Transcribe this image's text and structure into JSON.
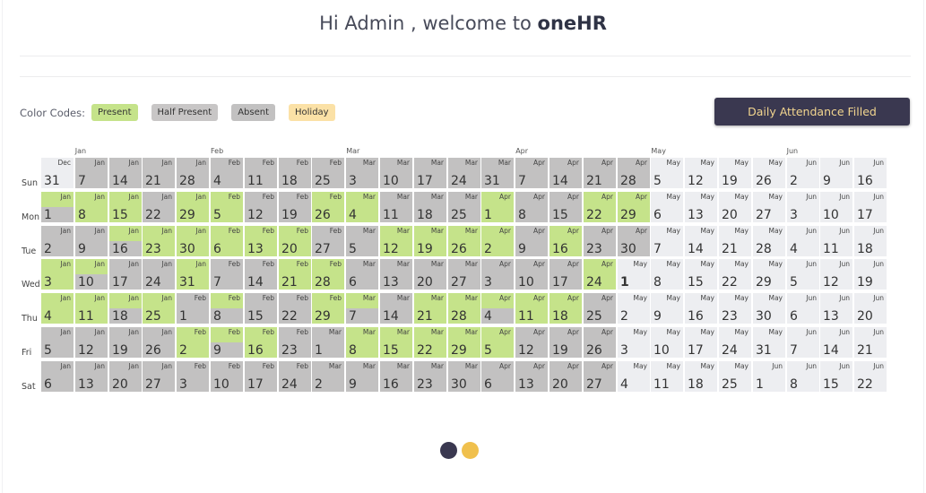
{
  "header": {
    "greeting": "Hi Admin , welcome to",
    "brand": "oneHR"
  },
  "legend": {
    "label": "Color Codes:",
    "items": [
      {
        "label": "Present",
        "kind": "present"
      },
      {
        "label": "Half Present",
        "kind": "half"
      },
      {
        "label": "Absent",
        "kind": "absent"
      },
      {
        "label": "Holiday",
        "kind": "holiday"
      }
    ]
  },
  "action_button": "Daily Attendance Filled",
  "colors": {
    "present": "#c5e38a",
    "absent": "#c2c1c1",
    "holiday": "#fbe1a6",
    "future": "#edeef1",
    "button_bg": "#3a3850",
    "button_text": "#f3d68f",
    "carousel_dot_active": "#3a3850",
    "carousel_dot": "#f0c04d"
  },
  "calendar": {
    "month_labels": [
      {
        "label": "Jan",
        "week": 1
      },
      {
        "label": "Feb",
        "week": 5
      },
      {
        "label": "Mar",
        "week": 9
      },
      {
        "label": "Apr",
        "week": 14
      },
      {
        "label": "May",
        "week": 18
      },
      {
        "label": "Jun",
        "week": 22
      }
    ],
    "day_labels": [
      "Sun",
      "Mon",
      "Tue",
      "Wed",
      "Thu",
      "Fri",
      "Sat"
    ],
    "weeks": [
      [
        [
          "Dec",
          "31",
          "future"
        ],
        [
          "Jan",
          "1",
          "half"
        ],
        [
          "Jan",
          "2",
          "absent"
        ],
        [
          "Jan",
          "3",
          "present"
        ],
        [
          "Jan",
          "4",
          "present"
        ],
        [
          "Jan",
          "5",
          "absent"
        ],
        [
          "Jan",
          "6",
          "absent"
        ]
      ],
      [
        [
          "Jan",
          "7",
          "absent"
        ],
        [
          "Jan",
          "8",
          "present"
        ],
        [
          "Jan",
          "9",
          "absent"
        ],
        [
          "Jan",
          "10",
          "half"
        ],
        [
          "Jan",
          "11",
          "present"
        ],
        [
          "Jan",
          "12",
          "absent"
        ],
        [
          "Jan",
          "13",
          "absent"
        ]
      ],
      [
        [
          "Jan",
          "14",
          "absent"
        ],
        [
          "Jan",
          "15",
          "present"
        ],
        [
          "Jan",
          "16",
          "half"
        ],
        [
          "Jan",
          "17",
          "absent"
        ],
        [
          "Jan",
          "18",
          "half"
        ],
        [
          "Jan",
          "19",
          "absent"
        ],
        [
          "Jan",
          "20",
          "absent"
        ]
      ],
      [
        [
          "Jan",
          "21",
          "absent"
        ],
        [
          "Jan",
          "22",
          "absent"
        ],
        [
          "Jan",
          "23",
          "present"
        ],
        [
          "Jan",
          "24",
          "absent"
        ],
        [
          "Jan",
          "25",
          "present"
        ],
        [
          "Jan",
          "26",
          "absent"
        ],
        [
          "Jan",
          "27",
          "absent"
        ]
      ],
      [
        [
          "Jan",
          "28",
          "absent"
        ],
        [
          "Jan",
          "29",
          "present"
        ],
        [
          "Jan",
          "30",
          "present"
        ],
        [
          "Jan",
          "31",
          "present"
        ],
        [
          "Feb",
          "1",
          "absent"
        ],
        [
          "Feb",
          "2",
          "present"
        ],
        [
          "Feb",
          "3",
          "absent"
        ]
      ],
      [
        [
          "Feb",
          "4",
          "absent"
        ],
        [
          "Feb",
          "5",
          "present"
        ],
        [
          "Feb",
          "6",
          "present"
        ],
        [
          "Feb",
          "7",
          "absent"
        ],
        [
          "Feb",
          "8",
          "half"
        ],
        [
          "Feb",
          "9",
          "half"
        ],
        [
          "Feb",
          "10",
          "absent"
        ]
      ],
      [
        [
          "Feb",
          "11",
          "absent"
        ],
        [
          "Feb",
          "12",
          "absent"
        ],
        [
          "Feb",
          "13",
          "present"
        ],
        [
          "Feb",
          "14",
          "absent"
        ],
        [
          "Feb",
          "15",
          "absent"
        ],
        [
          "Feb",
          "16",
          "present"
        ],
        [
          "Feb",
          "17",
          "absent"
        ]
      ],
      [
        [
          "Feb",
          "18",
          "absent"
        ],
        [
          "Feb",
          "19",
          "absent"
        ],
        [
          "Feb",
          "20",
          "present"
        ],
        [
          "Feb",
          "21",
          "present"
        ],
        [
          "Feb",
          "22",
          "absent"
        ],
        [
          "Feb",
          "23",
          "absent"
        ],
        [
          "Feb",
          "24",
          "absent"
        ]
      ],
      [
        [
          "Feb",
          "25",
          "absent"
        ],
        [
          "Feb",
          "26",
          "present"
        ],
        [
          "Feb",
          "27",
          "absent"
        ],
        [
          "Feb",
          "28",
          "present"
        ],
        [
          "Feb",
          "29",
          "present"
        ],
        [
          "Mar",
          "1",
          "absent"
        ],
        [
          "Mar",
          "2",
          "absent"
        ]
      ],
      [
        [
          "Mar",
          "3",
          "absent"
        ],
        [
          "Mar",
          "4",
          "present"
        ],
        [
          "Mar",
          "5",
          "absent"
        ],
        [
          "Mar",
          "6",
          "absent"
        ],
        [
          "Mar",
          "7",
          "half"
        ],
        [
          "Mar",
          "8",
          "present"
        ],
        [
          "Mar",
          "9",
          "absent"
        ]
      ],
      [
        [
          "Mar",
          "10",
          "absent"
        ],
        [
          "Mar",
          "11",
          "absent"
        ],
        [
          "Mar",
          "12",
          "present"
        ],
        [
          "Mar",
          "13",
          "absent"
        ],
        [
          "Mar",
          "14",
          "absent"
        ],
        [
          "Mar",
          "15",
          "present"
        ],
        [
          "Mar",
          "16",
          "absent"
        ]
      ],
      [
        [
          "Mar",
          "17",
          "absent"
        ],
        [
          "Mar",
          "18",
          "absent"
        ],
        [
          "Mar",
          "19",
          "present"
        ],
        [
          "Mar",
          "20",
          "absent"
        ],
        [
          "Mar",
          "21",
          "present"
        ],
        [
          "Mar",
          "22",
          "present"
        ],
        [
          "Mar",
          "23",
          "absent"
        ]
      ],
      [
        [
          "Mar",
          "24",
          "absent"
        ],
        [
          "Mar",
          "25",
          "absent"
        ],
        [
          "Mar",
          "26",
          "present"
        ],
        [
          "Mar",
          "27",
          "absent"
        ],
        [
          "Mar",
          "28",
          "present"
        ],
        [
          "Mar",
          "29",
          "present"
        ],
        [
          "Mar",
          "30",
          "absent"
        ]
      ],
      [
        [
          "Mar",
          "31",
          "absent"
        ],
        [
          "Apr",
          "1",
          "present"
        ],
        [
          "Apr",
          "2",
          "present"
        ],
        [
          "Apr",
          "3",
          "absent"
        ],
        [
          "Apr",
          "4",
          "half"
        ],
        [
          "Apr",
          "5",
          "present"
        ],
        [
          "Apr",
          "6",
          "absent"
        ]
      ],
      [
        [
          "Apr",
          "7",
          "absent"
        ],
        [
          "Apr",
          "8",
          "absent"
        ],
        [
          "Apr",
          "9",
          "absent"
        ],
        [
          "Apr",
          "10",
          "absent"
        ],
        [
          "Apr",
          "11",
          "present"
        ],
        [
          "Apr",
          "12",
          "absent"
        ],
        [
          "Apr",
          "13",
          "absent"
        ]
      ],
      [
        [
          "Apr",
          "14",
          "absent"
        ],
        [
          "Apr",
          "15",
          "absent"
        ],
        [
          "Apr",
          "16",
          "present"
        ],
        [
          "Apr",
          "17",
          "absent"
        ],
        [
          "Apr",
          "18",
          "present"
        ],
        [
          "Apr",
          "19",
          "absent"
        ],
        [
          "Apr",
          "20",
          "absent"
        ]
      ],
      [
        [
          "Apr",
          "21",
          "absent"
        ],
        [
          "Apr",
          "22",
          "present"
        ],
        [
          "Apr",
          "23",
          "absent"
        ],
        [
          "Apr",
          "24",
          "present"
        ],
        [
          "Apr",
          "25",
          "absent"
        ],
        [
          "Apr",
          "26",
          "absent"
        ],
        [
          "Apr",
          "27",
          "absent"
        ]
      ],
      [
        [
          "Apr",
          "28",
          "absent"
        ],
        [
          "Apr",
          "29",
          "present"
        ],
        [
          "Apr",
          "30",
          "absent"
        ],
        [
          "May",
          "1",
          "today"
        ],
        [
          "May",
          "2",
          "future"
        ],
        [
          "May",
          "3",
          "future"
        ],
        [
          "May",
          "4",
          "future"
        ]
      ],
      [
        [
          "May",
          "5",
          "future"
        ],
        [
          "May",
          "6",
          "future"
        ],
        [
          "May",
          "7",
          "future"
        ],
        [
          "May",
          "8",
          "future"
        ],
        [
          "May",
          "9",
          "future"
        ],
        [
          "May",
          "10",
          "future"
        ],
        [
          "May",
          "11",
          "future"
        ]
      ],
      [
        [
          "May",
          "12",
          "future"
        ],
        [
          "May",
          "13",
          "future"
        ],
        [
          "May",
          "14",
          "future"
        ],
        [
          "May",
          "15",
          "future"
        ],
        [
          "May",
          "16",
          "future"
        ],
        [
          "May",
          "17",
          "future"
        ],
        [
          "May",
          "18",
          "future"
        ]
      ],
      [
        [
          "May",
          "19",
          "future"
        ],
        [
          "May",
          "20",
          "future"
        ],
        [
          "May",
          "21",
          "future"
        ],
        [
          "May",
          "22",
          "future"
        ],
        [
          "May",
          "23",
          "future"
        ],
        [
          "May",
          "24",
          "future"
        ],
        [
          "May",
          "25",
          "future"
        ]
      ],
      [
        [
          "May",
          "26",
          "future"
        ],
        [
          "May",
          "27",
          "future"
        ],
        [
          "May",
          "28",
          "future"
        ],
        [
          "May",
          "29",
          "future"
        ],
        [
          "May",
          "30",
          "future"
        ],
        [
          "May",
          "31",
          "future"
        ],
        [
          "Jun",
          "1",
          "future"
        ]
      ],
      [
        [
          "Jun",
          "2",
          "future"
        ],
        [
          "Jun",
          "3",
          "future"
        ],
        [
          "Jun",
          "4",
          "future"
        ],
        [
          "Jun",
          "5",
          "future"
        ],
        [
          "Jun",
          "6",
          "future"
        ],
        [
          "Jun",
          "7",
          "future"
        ],
        [
          "Jun",
          "8",
          "future"
        ]
      ],
      [
        [
          "Jun",
          "9",
          "future"
        ],
        [
          "Jun",
          "10",
          "future"
        ],
        [
          "Jun",
          "11",
          "future"
        ],
        [
          "Jun",
          "12",
          "future"
        ],
        [
          "Jun",
          "13",
          "future"
        ],
        [
          "Jun",
          "14",
          "future"
        ],
        [
          "Jun",
          "15",
          "future"
        ]
      ],
      [
        [
          "Jun",
          "16",
          "future"
        ],
        [
          "Jun",
          "17",
          "future"
        ],
        [
          "Jun",
          "18",
          "future"
        ],
        [
          "Jun",
          "19",
          "future"
        ],
        [
          "Jun",
          "20",
          "future"
        ],
        [
          "Jun",
          "21",
          "future"
        ],
        [
          "Jun",
          "22",
          "future"
        ]
      ]
    ]
  },
  "carousel": {
    "slides": 2,
    "active": 1
  }
}
